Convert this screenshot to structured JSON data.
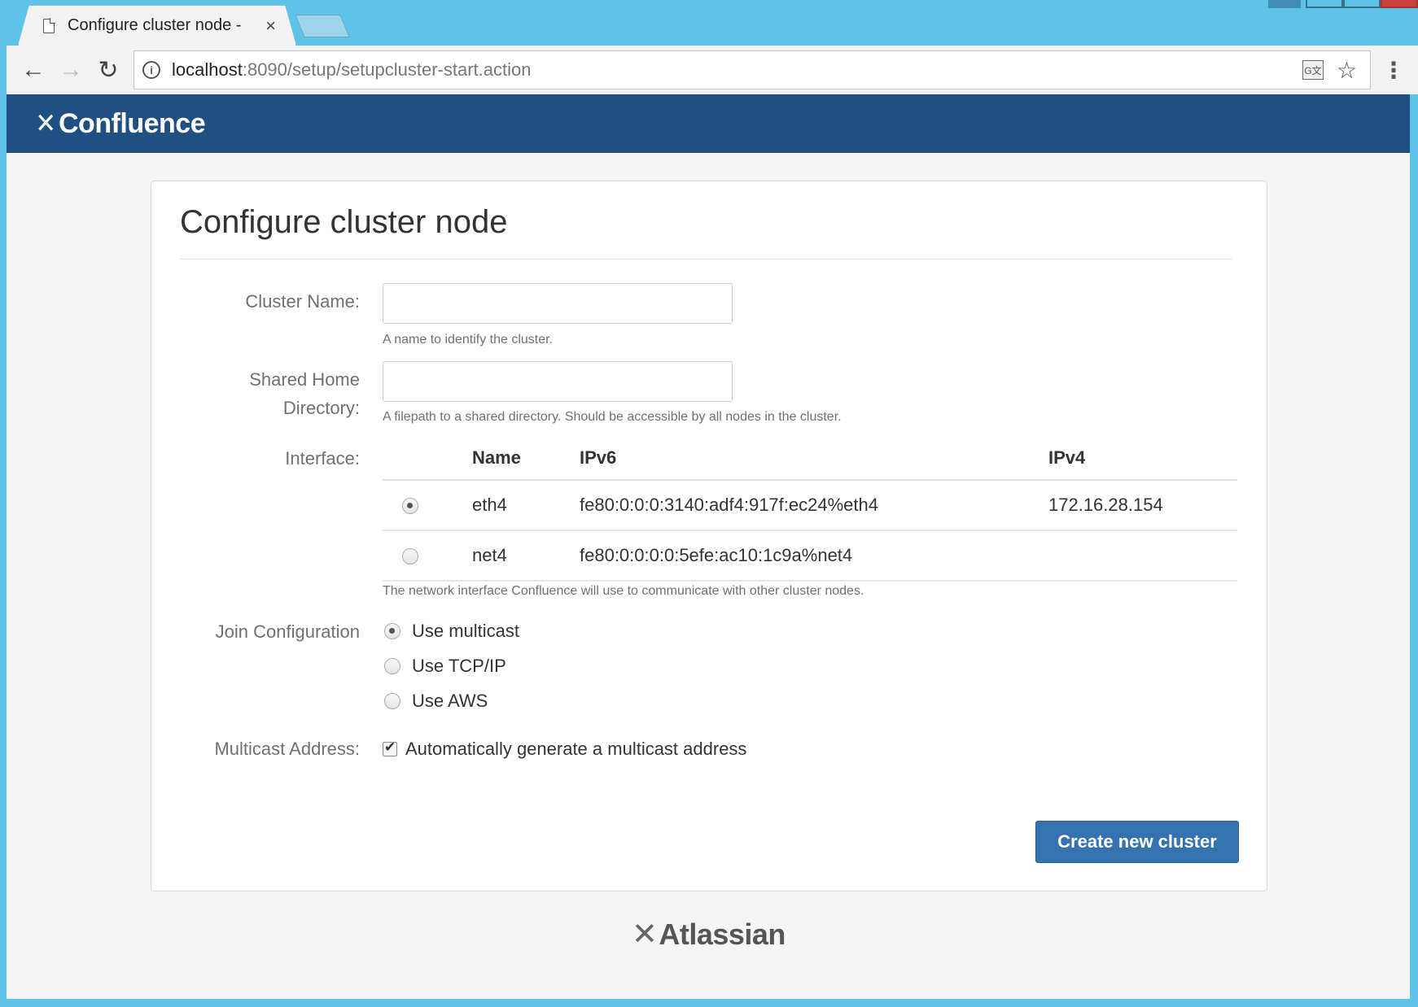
{
  "browser": {
    "tab_title": "Configure cluster node -",
    "tab_close": "×",
    "url_host": "localhost",
    "url_rest": ":8090/setup/setupcluster-start.action",
    "icons": {
      "back": "←",
      "forward": "→",
      "reload": "↻",
      "info": "i",
      "translate": "G文",
      "bookmark": "☆",
      "menu": "⋮"
    }
  },
  "app": {
    "logo_mark": "✕",
    "logo_text": "Confluence"
  },
  "form": {
    "title": "Configure cluster node",
    "cluster_name_label": "Cluster Name:",
    "cluster_name_value": "",
    "cluster_name_help": "A name to identify the cluster.",
    "shared_home_label_line1": "Shared Home",
    "shared_home_label_line2": "Directory:",
    "shared_home_value": "",
    "shared_home_help": "A filepath to a shared directory. Should be accessible by all nodes in the cluster.",
    "interface_label": "Interface:",
    "interface_table": {
      "headers": {
        "name": "Name",
        "ipv6": "IPv6",
        "ipv4": "IPv4"
      },
      "rows": [
        {
          "name": "eth4",
          "ipv6": "fe80:0:0:0:3140:adf4:917f:ec24%eth4",
          "ipv4": "172.16.28.154",
          "selected": true
        },
        {
          "name": "net4",
          "ipv6": "fe80:0:0:0:0:5efe:ac10:1c9a%net4",
          "ipv4": "",
          "selected": false
        }
      ]
    },
    "interface_help": "The network interface Confluence will use to communicate with other cluster nodes.",
    "join_label": "Join Configuration",
    "join_options": [
      {
        "label": "Use multicast",
        "selected": true
      },
      {
        "label": "Use TCP/IP",
        "selected": false
      },
      {
        "label": "Use AWS",
        "selected": false
      }
    ],
    "multicast_label": "Multicast Address:",
    "multicast_checkbox_label": "Automatically generate a multicast address",
    "multicast_checked": true,
    "submit_label": "Create new cluster"
  },
  "footer": {
    "logo_mark": "✕",
    "logo_text": "Atlassian"
  },
  "colors": {
    "header_bg": "#205081",
    "button_bg": "#3572b0",
    "desktop_bg": "#5fc3e8"
  }
}
